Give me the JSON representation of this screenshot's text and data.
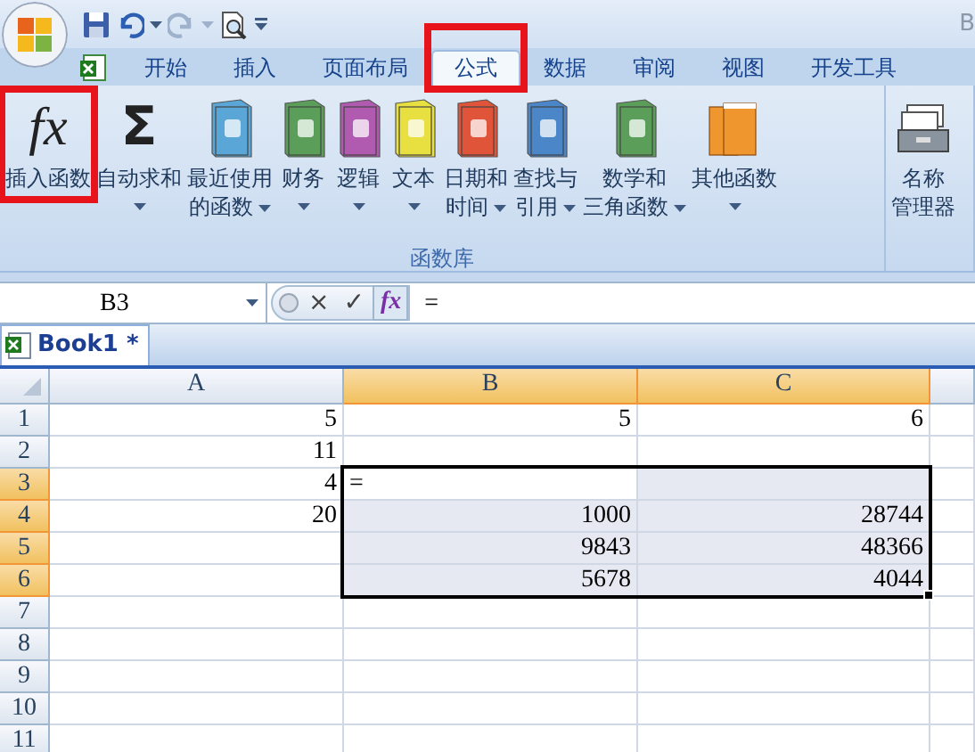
{
  "title_bar": {
    "title": "B"
  },
  "tabs": [
    {
      "label": "开始",
      "selected": false,
      "highlighted": false
    },
    {
      "label": "插入",
      "selected": false,
      "highlighted": false
    },
    {
      "label": "页面布局",
      "selected": false,
      "highlighted": false
    },
    {
      "label": "公式",
      "selected": true,
      "highlighted": true
    },
    {
      "label": "数据",
      "selected": false,
      "highlighted": false
    },
    {
      "label": "审阅",
      "selected": false,
      "highlighted": false
    },
    {
      "label": "视图",
      "selected": false,
      "highlighted": false
    },
    {
      "label": "开发工具",
      "selected": false,
      "highlighted": false
    }
  ],
  "ribbon": {
    "groups": [
      {
        "label": "函数库",
        "buttons": [
          {
            "kind": "glyph",
            "glyph": "fx",
            "lines": [
              "插入函数"
            ],
            "dropdown": false,
            "highlighted": true
          },
          {
            "kind": "glyph",
            "glyph": "Σ",
            "lines": [
              "自动求和"
            ],
            "dropdown": true,
            "highlighted": false
          },
          {
            "kind": "book",
            "color": "#5aa6d6",
            "lines": [
              "最近使用",
              "的函数"
            ],
            "dropdown": true,
            "highlighted": false
          },
          {
            "kind": "book",
            "color": "#5a9e5a",
            "lines": [
              "财务"
            ],
            "dropdown": true,
            "highlighted": false
          },
          {
            "kind": "book",
            "color": "#b05ab0",
            "lines": [
              "逻辑"
            ],
            "dropdown": true,
            "highlighted": false
          },
          {
            "kind": "book",
            "color": "#e8e040",
            "lines": [
              "文本"
            ],
            "dropdown": true,
            "highlighted": false
          },
          {
            "kind": "book",
            "color": "#e0553a",
            "lines": [
              "日期和",
              "时间"
            ],
            "dropdown": true,
            "highlighted": false
          },
          {
            "kind": "book",
            "color": "#4a86c8",
            "lines": [
              "查找与",
              "引用"
            ],
            "dropdown": true,
            "highlighted": false
          },
          {
            "kind": "book",
            "color": "#5a9e5a",
            "lines": [
              "数学和",
              "三角函数"
            ],
            "dropdown": true,
            "highlighted": false
          },
          {
            "kind": "books",
            "color": "#f0962e",
            "lines": [
              "其他函数"
            ],
            "dropdown": true,
            "highlighted": false
          }
        ]
      },
      {
        "buttons": [
          {
            "kind": "card-file",
            "lines": [
              "名称",
              "管理器"
            ],
            "dropdown": false,
            "highlighted": false
          }
        ]
      }
    ]
  },
  "formula_bar": {
    "name_box": "B3",
    "buttons": [
      "×",
      "✓",
      "fx"
    ],
    "formula": "="
  },
  "workbook_tabs": [
    {
      "label": "Book1 *",
      "selected": true
    }
  ],
  "sheet": {
    "columns": [
      {
        "label": "A",
        "selected": false
      },
      {
        "label": "B",
        "selected": true
      },
      {
        "label": "C",
        "selected": true
      }
    ],
    "rows": [
      {
        "header": "1",
        "selected": false,
        "cells": [
          {
            "text": "5",
            "kind": "number",
            "selected": false
          },
          {
            "text": "5",
            "kind": "number",
            "selected": false
          },
          {
            "text": "6",
            "kind": "number",
            "selected": false
          }
        ]
      },
      {
        "header": "2",
        "selected": false,
        "cells": [
          {
            "text": "11",
            "kind": "number",
            "selected": false
          },
          {
            "selected": false
          },
          {
            "selected": false
          }
        ]
      },
      {
        "header": "3",
        "selected": true,
        "cells": [
          {
            "text": "4",
            "kind": "number",
            "selected": false
          },
          {
            "text": "=",
            "kind": "text",
            "selected": true,
            "active": true
          },
          {
            "selected": true
          }
        ]
      },
      {
        "header": "4",
        "selected": true,
        "cells": [
          {
            "text": "20",
            "kind": "number",
            "selected": false
          },
          {
            "text": "1000",
            "kind": "number",
            "selected": true
          },
          {
            "text": "28744",
            "kind": "number",
            "selected": true
          }
        ]
      },
      {
        "header": "5",
        "selected": true,
        "cells": [
          {
            "selected": false
          },
          {
            "text": "9843",
            "kind": "number",
            "selected": true
          },
          {
            "text": "48366",
            "kind": "number",
            "selected": true
          }
        ]
      },
      {
        "header": "6",
        "selected": true,
        "cells": [
          {
            "selected": false
          },
          {
            "text": "5678",
            "kind": "number",
            "selected": true
          },
          {
            "text": "4044",
            "kind": "number",
            "selected": true
          }
        ]
      },
      {
        "header": "7",
        "selected": false,
        "cells": [
          {
            "selected": false
          },
          {
            "selected": false
          },
          {
            "selected": false
          }
        ]
      },
      {
        "header": "8",
        "selected": false,
        "cells": [
          {
            "selected": false
          },
          {
            "selected": false
          },
          {
            "selected": false
          }
        ]
      },
      {
        "header": "9",
        "selected": false,
        "cells": [
          {
            "selected": false
          },
          {
            "selected": false
          },
          {
            "selected": false
          }
        ]
      },
      {
        "header": "10",
        "selected": false,
        "cells": [
          {
            "selected": false
          },
          {
            "selected": false
          },
          {
            "selected": false
          }
        ]
      },
      {
        "header": "11",
        "selected": false,
        "cells": [
          {
            "selected": false
          },
          {
            "selected": false
          },
          {
            "selected": false
          }
        ]
      }
    ]
  }
}
